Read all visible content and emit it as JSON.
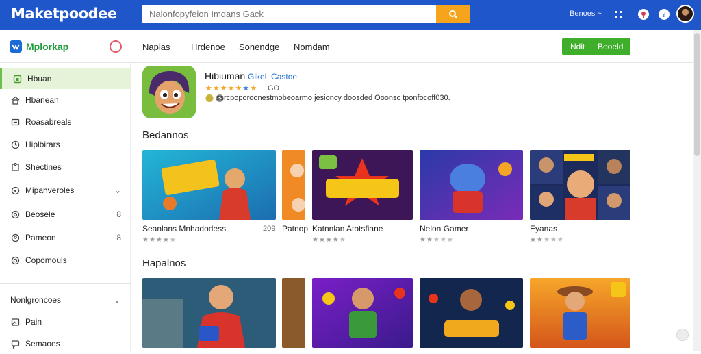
{
  "topbar": {
    "brand": "Maketpoodee",
    "search_placeholder": "Nalonfopyfeion Imdans Gack",
    "link": "Benoes ~",
    "icons": [
      "grid-icon",
      "notification-icon",
      "help-icon"
    ]
  },
  "subbar": {
    "logo_text": "Mplorkap",
    "tabs": [
      "Naplas",
      "Hrdenoe",
      "Sonendge",
      "Nomdam"
    ],
    "button_left": "Ndit",
    "button_right": "Booeld"
  },
  "sidebar": {
    "items": [
      {
        "label": "Hbuan",
        "icon": "home-icon",
        "right": ""
      },
      {
        "label": "Hbanean",
        "icon": "house-icon",
        "right": ""
      },
      {
        "label": "Roasabreals",
        "icon": "store-icon",
        "right": ""
      },
      {
        "label": "Hiplbirars",
        "icon": "clock-icon",
        "right": ""
      },
      {
        "label": "Shectines",
        "icon": "puzzle-icon",
        "right": ""
      },
      {
        "label": "Mipahveroles",
        "icon": "users-icon",
        "right": "⌄"
      },
      {
        "label": "Beosele",
        "icon": "target-icon",
        "right": "8"
      },
      {
        "label": "Pameon",
        "icon": "pin-icon",
        "right": "8"
      },
      {
        "label": "Copomouls",
        "icon": "coupon-icon",
        "right": ""
      }
    ],
    "section_label": "Nonlgroncoes",
    "section_chevron": "⌄",
    "bottom_items": [
      {
        "label": "Pain",
        "icon": "image-icon"
      },
      {
        "label": "Semaoes",
        "icon": "chat-icon"
      }
    ]
  },
  "featured": {
    "title": "Hibiuman",
    "tag": "Gikel :Castoe",
    "rating_text": "GO",
    "description": "ssrcpoporoonestmobeoarmo jesioncy doosded Ooonsc tponfocoff030."
  },
  "sections": [
    {
      "title": "Bedannos",
      "cards": [
        {
          "title": "Seanlans Mnhadodess",
          "extra": "209",
          "rating": 4
        },
        {
          "title": "Patnop",
          "extra": "",
          "rating": 0
        },
        {
          "title": "Katnnlan Atotsfiane",
          "extra": "",
          "rating": 4
        },
        {
          "title": "Nelon Gamer",
          "extra": "",
          "rating": 2
        },
        {
          "title": "Eyanas",
          "extra": "",
          "rating": 2
        }
      ]
    },
    {
      "title": "Hapalnos",
      "cards": []
    }
  ],
  "colors": {
    "topbar": "#1f56c9",
    "search_button": "#f7a41d",
    "accent_green": "#3fae2a",
    "active_sidebar": "#e5f4d8",
    "star": "#f5a623"
  }
}
